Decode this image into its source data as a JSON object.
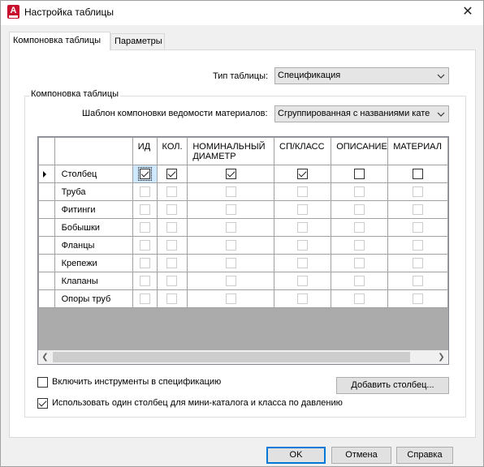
{
  "window": {
    "title": "Настройка таблицы",
    "app_icon_letter": "A"
  },
  "tabs": [
    {
      "label": "Компоновка таблицы",
      "active": true
    },
    {
      "label": "Параметры",
      "active": false
    }
  ],
  "table_type": {
    "label": "Тип таблицы:",
    "value": "Спецификация"
  },
  "group": {
    "title": "Компоновка таблицы"
  },
  "template": {
    "label": "Шаблон компоновки ведомости материалов:",
    "value": "Сгруппированная с названиями кате"
  },
  "grid": {
    "columns": [
      "ИД",
      "КОЛ.",
      "НОМИНАЛЬНЫЙ ДИАМЕТР",
      "СП/КЛАСС",
      "ОПИСАНИЕ",
      "МАТЕРИАЛ"
    ],
    "rows": [
      {
        "name": "Столбец",
        "current": true,
        "enabled": true,
        "checks": [
          true,
          true,
          true,
          true,
          false,
          false
        ]
      },
      {
        "name": "Труба",
        "current": false,
        "enabled": false,
        "checks": [
          false,
          false,
          false,
          false,
          false,
          false
        ]
      },
      {
        "name": "Фитинги",
        "current": false,
        "enabled": false,
        "checks": [
          false,
          false,
          false,
          false,
          false,
          false
        ]
      },
      {
        "name": "Бобышки",
        "current": false,
        "enabled": false,
        "checks": [
          false,
          false,
          false,
          false,
          false,
          false
        ]
      },
      {
        "name": "Фланцы",
        "current": false,
        "enabled": false,
        "checks": [
          false,
          false,
          false,
          false,
          false,
          false
        ]
      },
      {
        "name": "Крепежи",
        "current": false,
        "enabled": false,
        "checks": [
          false,
          false,
          false,
          false,
          false,
          false
        ]
      },
      {
        "name": "Клапаны",
        "current": false,
        "enabled": false,
        "checks": [
          false,
          false,
          false,
          false,
          false,
          false
        ]
      },
      {
        "name": "Опоры труб",
        "current": false,
        "enabled": false,
        "checks": [
          false,
          false,
          false,
          false,
          false,
          false
        ]
      }
    ]
  },
  "options": {
    "include_tools": {
      "label": "Включить инструменты в спецификацию",
      "checked": false
    },
    "single_column": {
      "label": "Использовать один столбец для мини-каталога и класса по давлению",
      "checked": true
    }
  },
  "buttons": {
    "add_column": "Добавить столбец...",
    "ok": "OK",
    "cancel": "Отмена",
    "help": "Справка"
  },
  "colors": {
    "accent": "#0078d7",
    "app_icon": "#c8102e"
  }
}
